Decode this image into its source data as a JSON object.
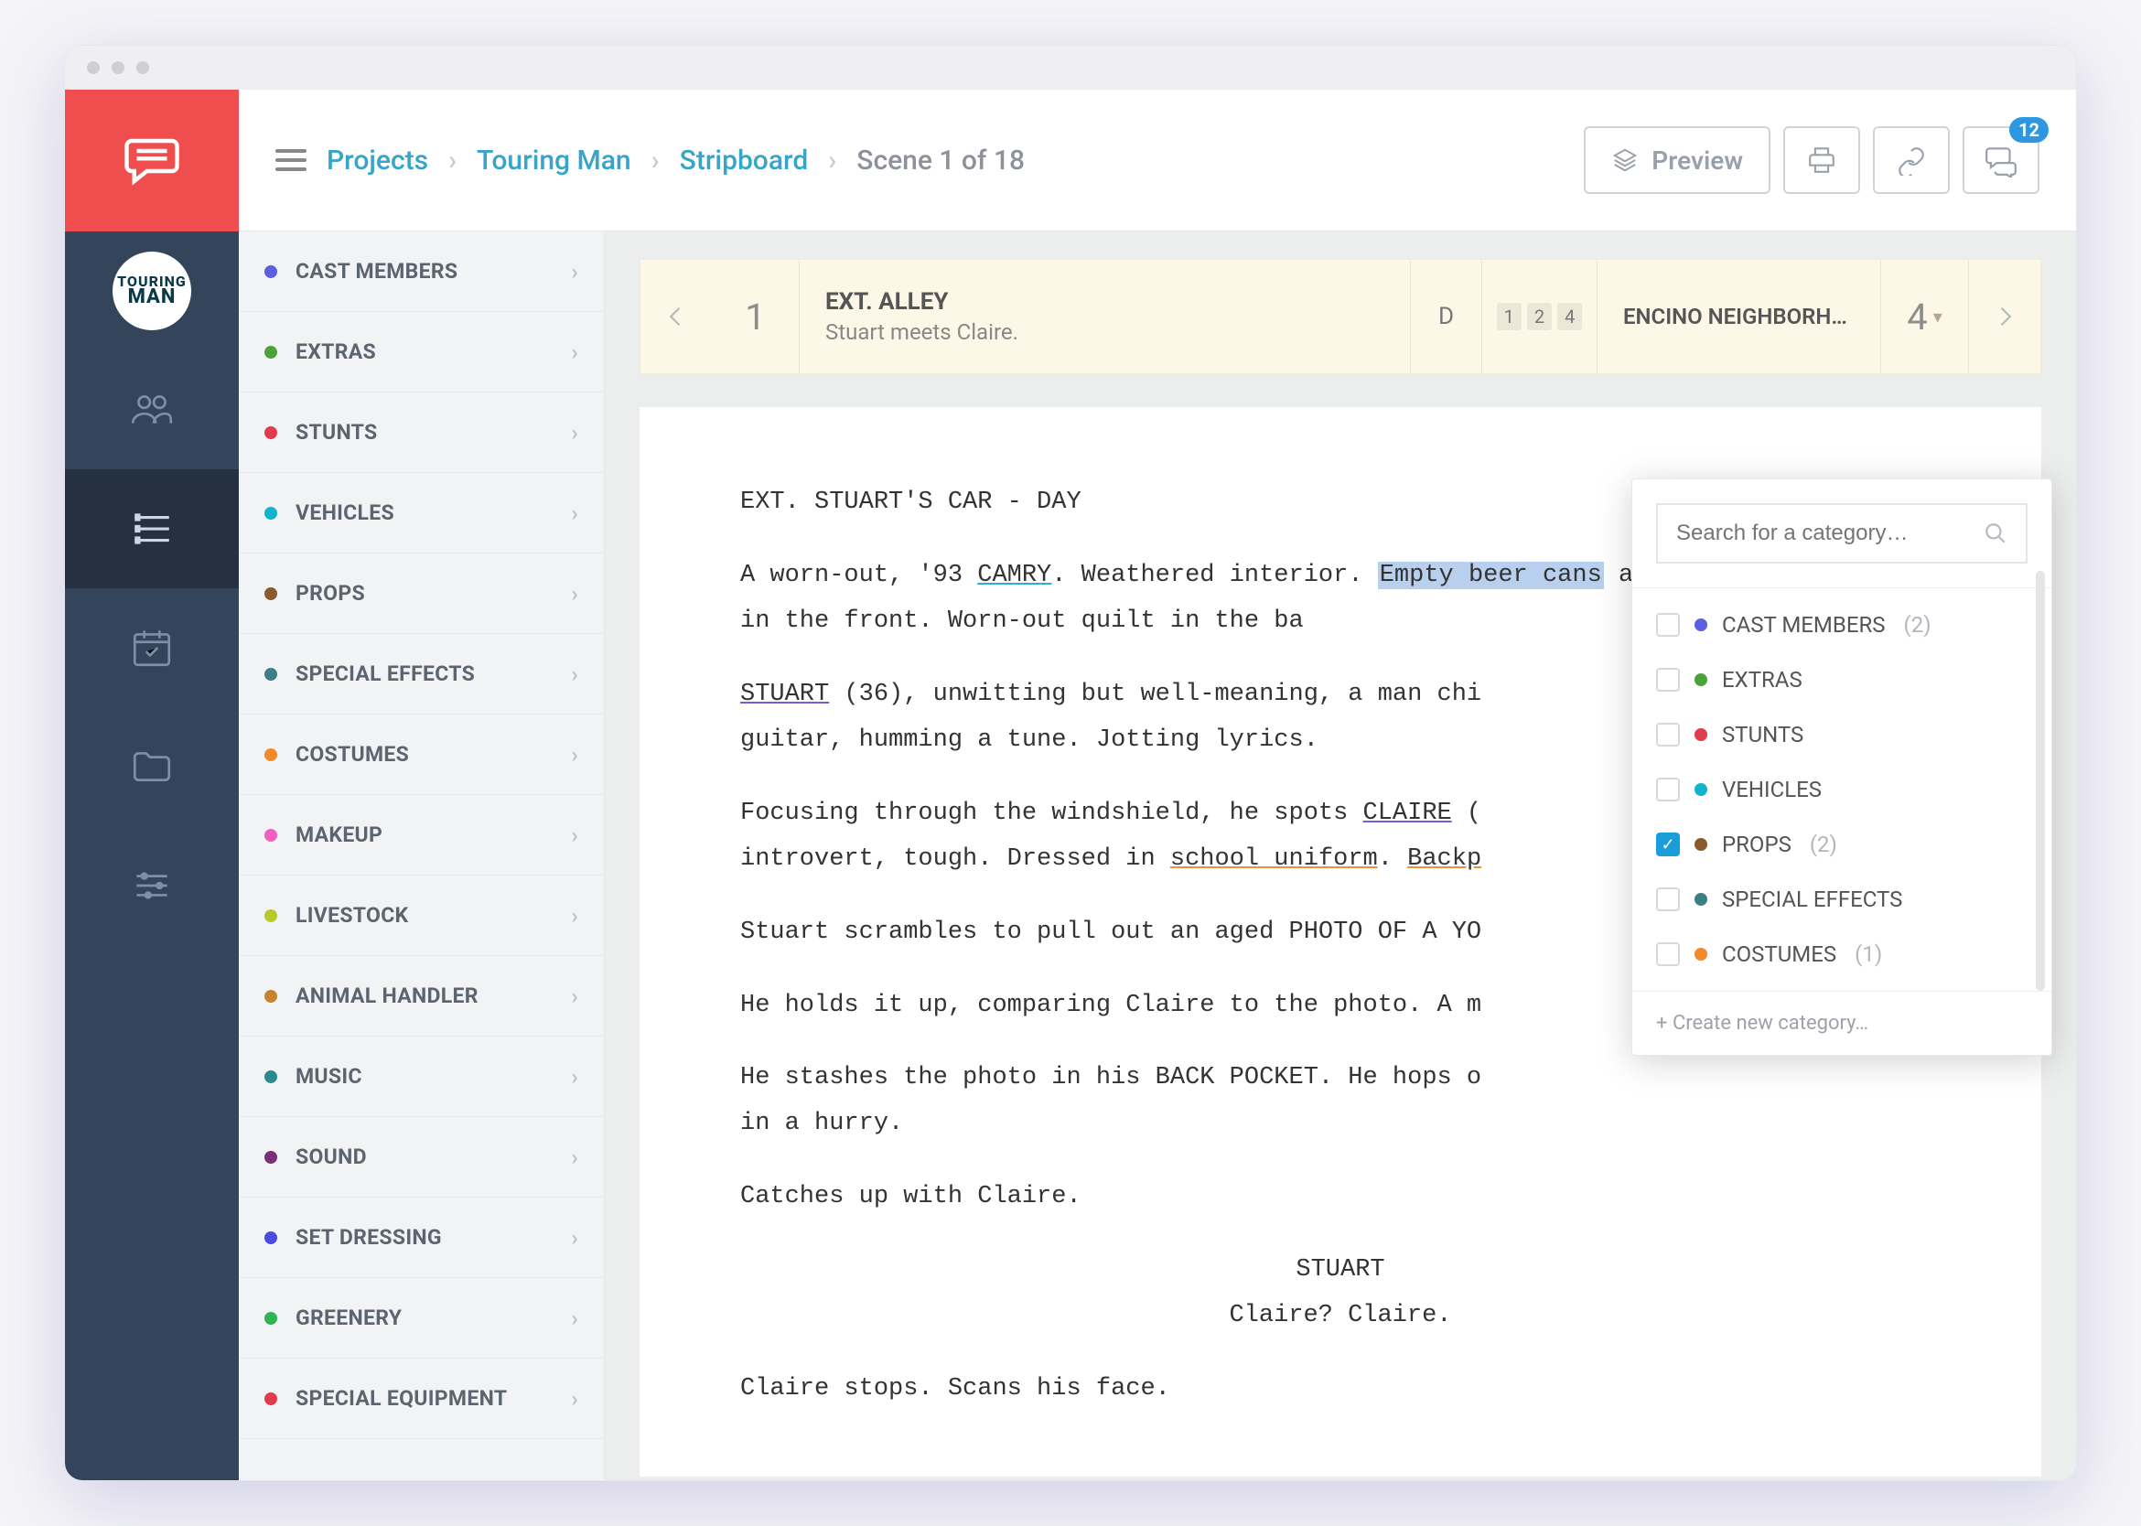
{
  "breadcrumb": {
    "projects": "Projects",
    "project": "Touring Man",
    "section": "Stripboard",
    "scene": "Scene 1 of 18"
  },
  "toolbar": {
    "preview": "Preview",
    "notif_count": "12"
  },
  "project_badge": {
    "l1": "TOURING",
    "l2": "MAN"
  },
  "categories": [
    {
      "label": "CAST MEMBERS",
      "color": "#5b5fe0"
    },
    {
      "label": "EXTRAS",
      "color": "#4aa33a"
    },
    {
      "label": "STUNTS",
      "color": "#e13b4d"
    },
    {
      "label": "VEHICLES",
      "color": "#12b3cc"
    },
    {
      "label": "PROPS",
      "color": "#8a5a2c"
    },
    {
      "label": "SPECIAL EFFECTS",
      "color": "#3a7e86"
    },
    {
      "label": "COSTUMES",
      "color": "#f08a2a"
    },
    {
      "label": "MAKEUP",
      "color": "#f15fc0"
    },
    {
      "label": "LIVESTOCK",
      "color": "#b7c92d"
    },
    {
      "label": "ANIMAL HANDLER",
      "color": "#c6842e"
    },
    {
      "label": "MUSIC",
      "color": "#2a8b8f"
    },
    {
      "label": "SOUND",
      "color": "#7a2f77"
    },
    {
      "label": "SET DRESSING",
      "color": "#4b4be2"
    },
    {
      "label": "GREENERY",
      "color": "#2fb451"
    },
    {
      "label": "SPECIAL EQUIPMENT",
      "color": "#e13b4d"
    }
  ],
  "strip": {
    "num": "1",
    "heading": "EXT. ALLEY",
    "summary": "Stuart meets Claire.",
    "daynight": "D",
    "cast_tags": [
      "1",
      "2",
      "4"
    ],
    "set": "ENCINO NEIGHBORH…",
    "pages": "4"
  },
  "script": {
    "slug": "EXT. STUART'S CAR - DAY",
    "p1a": "A worn-out, '93 ",
    "camry": "CAMRY",
    "p1b": ". Weathered interior. ",
    "beer": "Empty beer cans",
    "p1c": " and burger wrappers in the front. Worn-out quilt in the ba",
    "p2a": "",
    "stuart": "STUART",
    "p2b": " (36), unwitting but well-meaning, a man chi",
    "p2c": " guitar, humming a tune. Jotting lyrics.",
    "p3a": "Focusing through the windshield, he spots ",
    "claire": "CLAIRE",
    "p3b": " (",
    "p3c": " introvert, tough. Dressed in ",
    "uniform": "school uniform",
    "p3d": ". ",
    "backpack": "Backp",
    "p4": "Stuart scrambles to pull out an aged PHOTO OF A YO",
    "p5": "He holds it up, comparing Claire to the photo. A m",
    "p6": "He stashes the photo in his BACK POCKET. He hops o",
    "p6b": " in a hurry.",
    "p7": "Catches up with Claire.",
    "char": "STUART",
    "dlg": "Claire? Claire.",
    "p8": "Claire stops. Scans his face."
  },
  "popover": {
    "placeholder": "Search for a category…",
    "create": "+ Create new category…",
    "items": [
      {
        "label": "CAST MEMBERS",
        "color": "#5b5fe0",
        "count": "(2)",
        "checked": false
      },
      {
        "label": "EXTRAS",
        "color": "#4aa33a",
        "count": "",
        "checked": false
      },
      {
        "label": "STUNTS",
        "color": "#e13b4d",
        "count": "",
        "checked": false
      },
      {
        "label": "VEHICLES",
        "color": "#12b3cc",
        "count": "",
        "checked": false
      },
      {
        "label": "PROPS",
        "color": "#8a5a2c",
        "count": "(2)",
        "checked": true
      },
      {
        "label": "SPECIAL EFFECTS",
        "color": "#3a7e86",
        "count": "",
        "checked": false
      },
      {
        "label": "COSTUMES",
        "color": "#f08a2a",
        "count": "(1)",
        "checked": false
      }
    ]
  }
}
